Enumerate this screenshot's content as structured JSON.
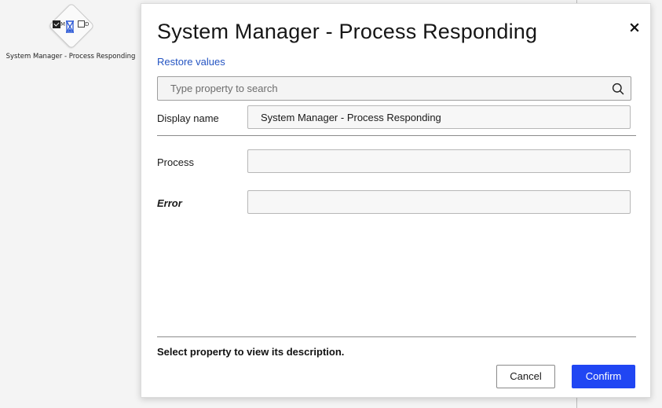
{
  "canvas": {
    "node": {
      "label": "System Manager - Process Responding",
      "badge_letters": [
        "M",
        "D"
      ],
      "icons": [
        "checkbox-checked-icon",
        "hourglass-icon",
        "checkbox-empty-icon"
      ]
    }
  },
  "dialog": {
    "title": "System Manager - Process Responding",
    "close_icon": "close-icon",
    "restore_label": "Restore values",
    "search": {
      "placeholder": "Type property to search",
      "value": "",
      "icon": "search-icon"
    },
    "properties": [
      {
        "label": "Display name",
        "value": "System Manager - Process Responding",
        "required": false
      },
      {
        "label": "Process",
        "value": "",
        "required": false
      },
      {
        "label": "Error",
        "value": "",
        "required": true
      }
    ],
    "description": "Select property to view its description.",
    "buttons": {
      "cancel": "Cancel",
      "confirm": "Confirm"
    }
  },
  "colors": {
    "accent": "#2046f3",
    "link": "#2454c2",
    "background": "#f4f4f4"
  }
}
